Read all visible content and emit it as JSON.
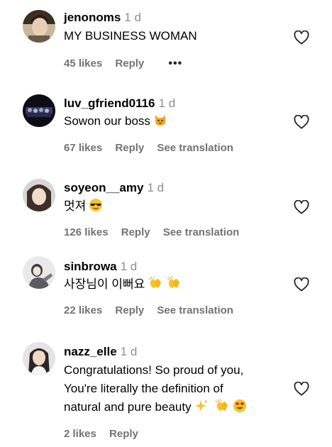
{
  "comments": [
    {
      "username": "jenonoms",
      "time": "1 d",
      "lines": [
        "MY BUSINESS WOMAN"
      ],
      "likes": "45 likes",
      "reply": "Reply",
      "more": "•••"
    },
    {
      "username": "luv_gfriend0116",
      "time": "1 d",
      "lines": [
        "Sowon our boss"
      ],
      "likes": "67 likes",
      "reply": "Reply",
      "translation": "See translation"
    },
    {
      "username": "soyeon__amy",
      "time": "1 d",
      "lines": [
        "멋져"
      ],
      "likes": "126 likes",
      "reply": "Reply",
      "translation": "See translation"
    },
    {
      "username": "sinbrowa",
      "time": "1 d",
      "lines": [
        "사장님이 이뻐요"
      ],
      "likes": "22 likes",
      "reply": "Reply",
      "translation": "See translation"
    },
    {
      "username": "nazz_elle",
      "time": "1 d",
      "lines": [
        "Congratulations! So proud of you,",
        "You're literally the definition of",
        "natural and pure beauty"
      ],
      "likes": "2 likes",
      "reply": "Reply"
    }
  ],
  "icons": {
    "heart": "heart-outline-icon",
    "emoji": [
      "cat-face-emoji",
      "sunglasses-emoji",
      "clapping-hands-emoji",
      "sparkles-emoji",
      "heart-eyes-emoji"
    ]
  },
  "colors": {
    "username": "#000000",
    "secondary": "#737373",
    "timestamp": "#8e8e8e"
  }
}
